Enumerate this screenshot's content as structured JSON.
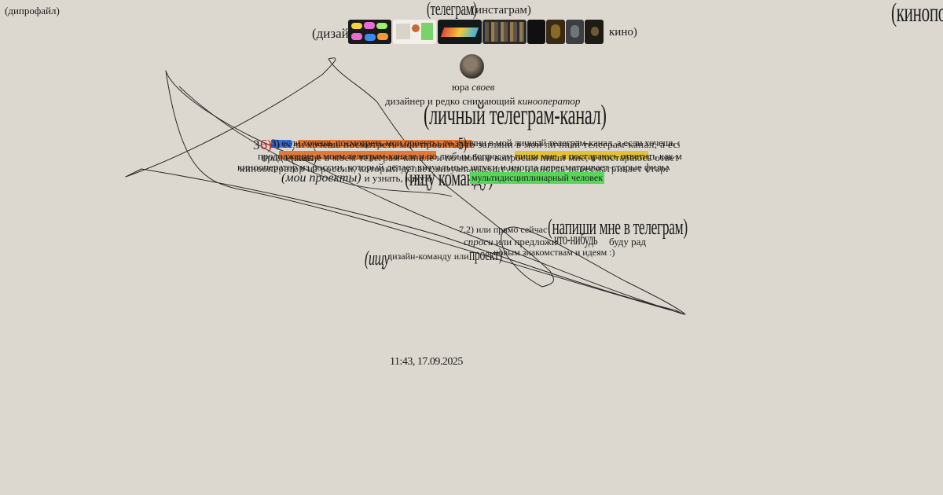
{
  "corner": {
    "left_link": "(дипрофайл)",
    "right_link": "(кинопоиск)"
  },
  "nav": {
    "telegram": "(телеграм)",
    "instagram": "(инстаграм)",
    "design": "(дизайн",
    "cinema": "кино)"
  },
  "profile": {
    "first_name": "юра",
    "last_name": "своев",
    "bio_prefix": "дизайнер и редко снимающий",
    "bio_role": "кинооператор",
    "channel_link": "(личный телеграм-канал)"
  },
  "overlap": {
    "line1": "3) если хочешь посмотреть мои проекты, то загляни в мой личный телеграм-канал, а если хочешь со мной работать",
    "line2": "продолжение в моем телеграм-канале и по любым вопросам пиши мне, я постараюсь ответить как можно скорее и подробнее",
    "line3": "кинооператор из россии, который делает визуальные штуки и иногда пересматривает старые фильмы ради создания",
    "projects_link": "(мои проекты)",
    "find_text": "и узнать, какую",
    "team_link": "(ищу команду)",
    "multi_word": "мультидисциплинарный человек",
    "num_a": "3",
    "num_b": "6)",
    "num_c": "5)",
    "mine_link": "(мои)"
  },
  "contact": {
    "line1_prefix": "7.2) или прямо сейчас",
    "telegram_link": "(напиши мне в телеграм)",
    "ask": "спроси",
    "or_offer": "или предложи",
    "something_link": "что-нибудь",
    "glad": "буду рад",
    "new_people": "новым знакомствам и идеям :)",
    "team_link": "(ищу",
    "team_suffix": "дизайн-команду или",
    "project_link": "проект)"
  },
  "timestamp": "11:43, 17.09.2025",
  "colors": {
    "background": "#dcd8cf",
    "highlight_orange": "#e07a3a",
    "highlight_blue": "#3a6fd8",
    "highlight_yellow": "#e3c23a",
    "highlight_green": "#58d65a"
  }
}
